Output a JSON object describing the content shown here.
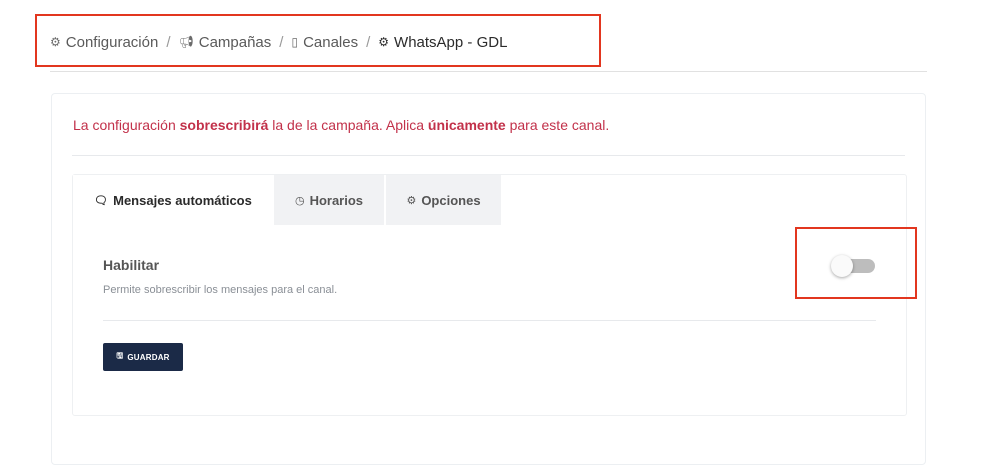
{
  "breadcrumb": {
    "items": [
      {
        "label": "Configuración",
        "icon": "gears-icon"
      },
      {
        "label": "Campañas",
        "icon": "bullhorn-icon"
      },
      {
        "label": "Canales",
        "icon": "mobile-icon"
      },
      {
        "label": "WhatsApp - GDL",
        "icon": "gears-icon"
      }
    ],
    "separator": "/"
  },
  "notice": {
    "part1": "La configuración ",
    "bold1": "sobrescribirá",
    "part2": " la de la campaña. Aplica ",
    "bold2": "únicamente",
    "part3": " para este canal."
  },
  "tabs": [
    {
      "label": "Mensajes automáticos",
      "icon": "comments-icon",
      "active": true
    },
    {
      "label": "Horarios",
      "icon": "clock-icon",
      "active": false
    },
    {
      "label": "Opciones",
      "icon": "gear-icon",
      "active": false
    }
  ],
  "setting": {
    "title": "Habilitar",
    "description": "Permite sobrescribir los mensajes para el canal.",
    "enabled": false
  },
  "save_button": {
    "label": "GUARDAR",
    "icon": "save-icon"
  },
  "colors": {
    "notice": "#c2314a",
    "button": "#1b2a47",
    "highlight": "#e2361f",
    "toggle_off": "#bdbdbd"
  }
}
